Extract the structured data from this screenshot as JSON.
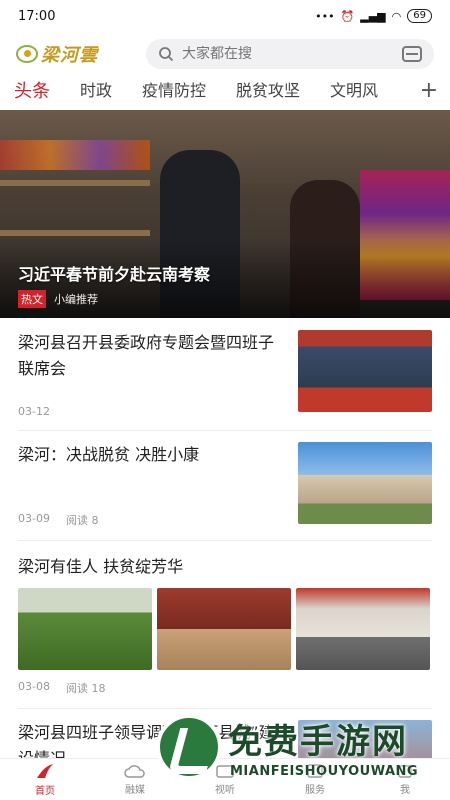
{
  "status": {
    "time": "17:00",
    "signal": "•••",
    "battery": "69"
  },
  "header": {
    "logo_text": "梁河雲",
    "search_placeholder": "大家都在搜"
  },
  "tabs": [
    "头条",
    "时政",
    "疫情防控",
    "脱贫攻坚",
    "文明风"
  ],
  "hero": {
    "title": "习近平春节前夕赴云南考察",
    "badge": "热文",
    "source": "小编推荐"
  },
  "news": [
    {
      "title": "梁河县召开县委政府专题会暨四班子联席会",
      "date": "03-12",
      "reads": ""
    },
    {
      "title": "梁河：决战脱贫 决胜小康",
      "date": "03-09",
      "reads": "阅读 8"
    },
    {
      "title": "梁河有佳人 扶贫绽芳华",
      "date": "03-08",
      "reads": "阅读 18"
    },
    {
      "title": "梁河县四班子领导调研“美丽县城”建设情况"
    }
  ],
  "bottom_nav": [
    "首页",
    "融媒",
    "视听",
    "服务",
    "我"
  ],
  "watermark": {
    "title": "免费手游网",
    "subtitle": "MIANFEISHOUYOUWANG"
  },
  "colors": {
    "accent": "#d2232a",
    "logo": "#c59a1e"
  }
}
